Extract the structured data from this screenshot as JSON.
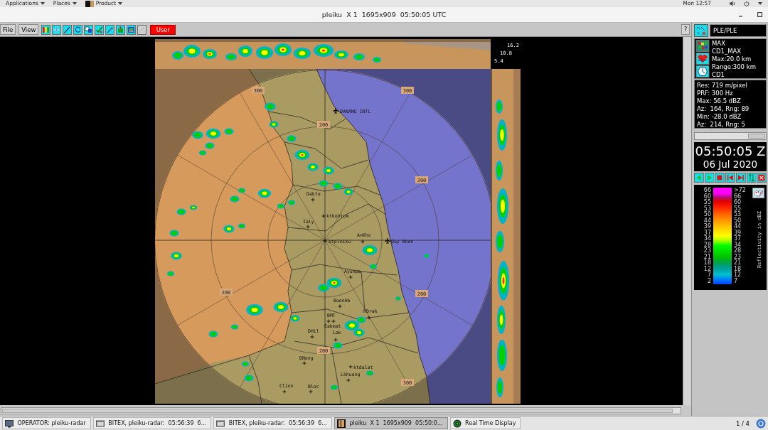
{
  "top_bar": {
    "menus": [
      {
        "label": "Applications",
        "kind": "menu"
      },
      {
        "label": "Places",
        "kind": "menu"
      },
      {
        "label": "Product",
        "kind": "app"
      }
    ],
    "clock": "Mon 12:57"
  },
  "window": {
    "title": "pleiku  X 1  1695x909  05:50:05 UTC"
  },
  "toolbar": {
    "menus": [
      "File",
      "View"
    ],
    "tools": [
      {
        "disabled": false
      },
      {
        "disabled": false
      },
      {
        "disabled": false
      },
      {
        "disabled": false
      },
      {
        "disabled": false
      },
      {
        "disabled": false
      },
      {
        "disabled": false
      },
      {
        "disabled": false
      },
      {
        "disabled": false
      },
      {
        "disabled": true
      }
    ],
    "user_button": "User",
    "help_button": "?"
  },
  "radar": {
    "heights": [
      "16.2",
      "10.8",
      "5.4"
    ],
    "range_labels": [
      "300",
      "300",
      "200",
      "200",
      "200",
      "200",
      "200",
      "300"
    ],
    "places": [
      {
        "label": "DANANG INTL",
        "kind": "airport"
      },
      {
        "label": "Dakto",
        "kind": "city"
      },
      {
        "label": "ktkontum",
        "kind": "city"
      },
      {
        "label": "Ialy",
        "kind": "city"
      },
      {
        "label": "ktpleiku",
        "kind": "city"
      },
      {
        "label": "AnKhe",
        "kind": "city"
      },
      {
        "label": "Quy Nhon",
        "kind": "airport"
      },
      {
        "label": "Ayunpa",
        "kind": "city"
      },
      {
        "label": "BuonHo",
        "kind": "city"
      },
      {
        "label": "BMT",
        "kind": "city"
      },
      {
        "label": "Eakmat",
        "kind": "city"
      },
      {
        "label": "DHil",
        "kind": "city"
      },
      {
        "label": "Lak",
        "kind": "city"
      },
      {
        "label": "HDrak",
        "kind": "city"
      },
      {
        "label": "DNong",
        "kind": "city"
      },
      {
        "label": "ktdalat",
        "kind": "city"
      },
      {
        "label": "Lkhuong",
        "kind": "city"
      },
      {
        "label": "Ctien",
        "kind": "city"
      },
      {
        "label": "Bloc",
        "kind": "city"
      }
    ]
  },
  "side_panel": {
    "product": "PLE/PLE",
    "product_lines": [
      "MAX",
      "CD1_MAX",
      "Max:20.0 km",
      "Range:300 km",
      "CD1"
    ],
    "stats": [
      "Res: 719 m/pixel",
      "PRF: 300 Hz",
      "Max: 56.5 dBZ",
      "Az:  164, Rng: 89",
      "Min: -28.0 dBZ",
      "Az:  214, Rng: 5"
    ],
    "time": "05:50:05 Z",
    "date": "06 Jul 2020",
    "legend": {
      "title": "Reflectivity in dBZ",
      "rows": [
        {
          "low": "66",
          "high": ">72"
        },
        {
          "low": "60",
          "high": "66"
        },
        {
          "low": "55",
          "high": "60"
        },
        {
          "low": "53",
          "high": "55"
        },
        {
          "low": "50",
          "high": "53"
        },
        {
          "low": "44",
          "high": "50"
        },
        {
          "low": "39",
          "high": "44"
        },
        {
          "low": "37",
          "high": "39"
        },
        {
          "low": "34",
          "high": "37"
        },
        {
          "low": "28",
          "high": "34"
        },
        {
          "low": "23",
          "high": "28"
        },
        {
          "low": "21",
          "high": "23"
        },
        {
          "low": "18",
          "high": "21"
        },
        {
          "low": "12",
          "high": "18"
        },
        {
          "low": "7",
          "high": "12"
        },
        {
          "low": "2",
          "high": "7"
        }
      ]
    }
  },
  "taskbar": {
    "items": [
      {
        "label": "OPERATOR: pleiku-radar",
        "kind": "terminal",
        "selected": false
      },
      {
        "label": "BITEX, pleiku-radar:  05:56:39  6...",
        "kind": "window",
        "selected": false
      },
      {
        "label": "BITEX, pleiku-radar:  05:56:39  6...",
        "kind": "window",
        "selected": false
      },
      {
        "label": "pleiku  X 1  1695x909  05:50:0...",
        "kind": "viewer",
        "selected": true
      },
      {
        "label": "Real Time Display",
        "kind": "app",
        "selected": false
      }
    ],
    "workspace": "1 / 4"
  }
}
